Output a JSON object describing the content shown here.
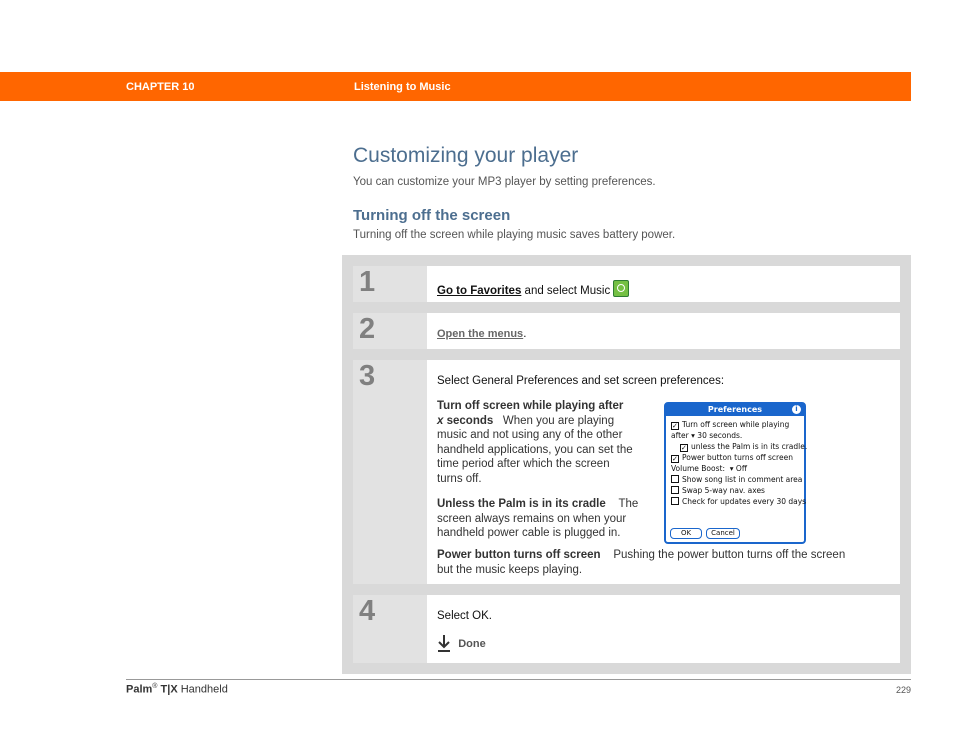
{
  "header": {
    "chapter": "CHAPTER 10",
    "section": "Listening to Music"
  },
  "page": {
    "title": "Customizing your player",
    "lead": "You can customize your MP3 player by setting preferences.",
    "subtitle": "Turning off the screen",
    "sublead": "Turning off the screen while playing music saves battery power."
  },
  "steps": [
    {
      "num": "1",
      "link": "Go to Favorites",
      "text": " and select Music"
    },
    {
      "num": "2",
      "link": "Open the menus",
      "text": "."
    },
    {
      "num": "3",
      "text": "Select General Preferences and set screen preferences:",
      "items": [
        {
          "term1": "Turn off screen while playing after",
          "term_x": "x",
          "term2": " seconds",
          "desc_first": "When you are playing",
          "desc_lines": [
            "music and not using any of the other",
            "handheld applications, you can set the",
            "time period after which the screen",
            "turns off."
          ]
        },
        {
          "term": "Unless the Palm is in its cradle",
          "desc_first": "The",
          "desc_lines": [
            "screen always remains on when your",
            "handheld power cable is plugged in."
          ]
        },
        {
          "term": "Power button turns off screen",
          "desc_first": "Pushing the power button turns off the screen",
          "desc_lines": [
            "but the music keeps playing."
          ]
        }
      ]
    },
    {
      "num": "4",
      "text": "Select OK.",
      "done": "Done"
    }
  ],
  "prefs_dialog": {
    "title": "Preferences",
    "info": "i",
    "row1": "Turn off screen while playing",
    "row2_a": "after",
    "row2_val": "30",
    "row2_b": "seconds.",
    "row3": "unless the Palm is in its cradle.",
    "row4": "Power button turns off screen",
    "row5_a": "Volume Boost:",
    "row5_val": "Off",
    "row6": "Show song list in comment area",
    "row7": "Swap 5-way nav. axes",
    "row8": "Check for updates every 30 days",
    "ok": "OK",
    "cancel": "Cancel"
  },
  "footer": {
    "brand": "Palm",
    "reg": "®",
    "model": "T|X",
    "product": " Handheld",
    "page_no": "229"
  }
}
